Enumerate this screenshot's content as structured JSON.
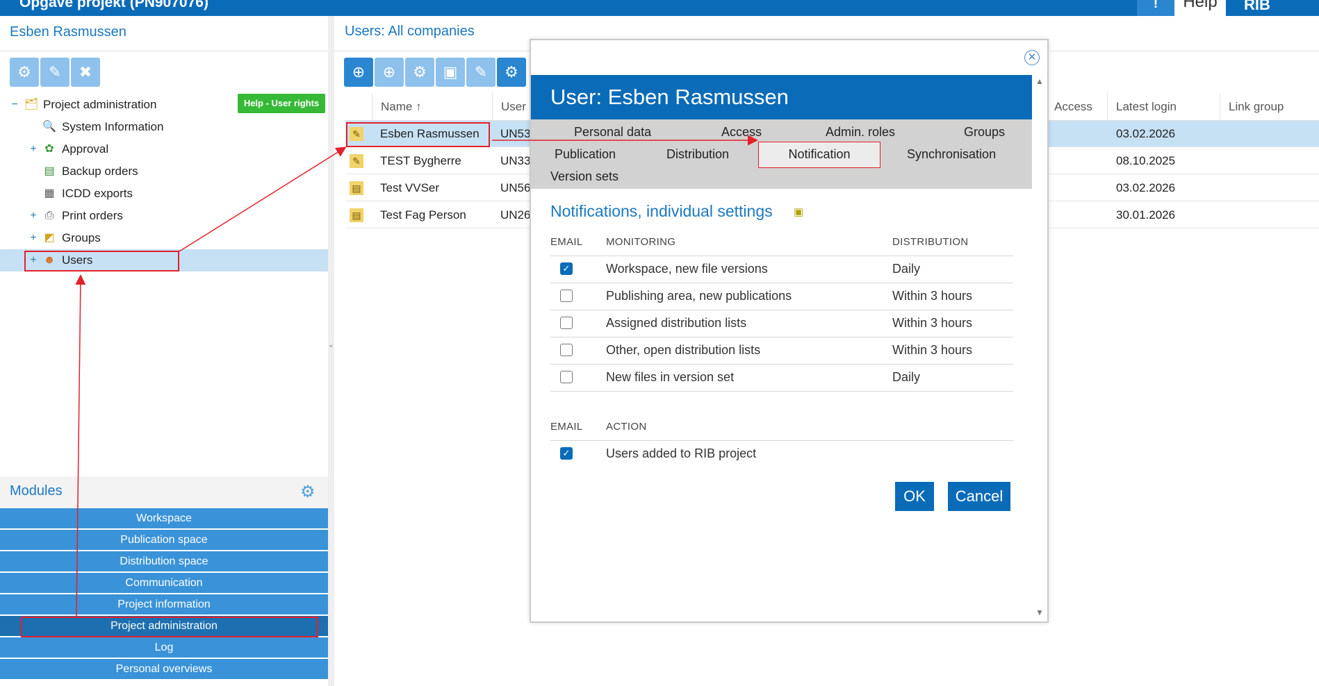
{
  "topbar": {
    "project_title": "Opgave projekt (PN907076)",
    "info_label": "!",
    "help_label": "Help",
    "logo_text": "RIB"
  },
  "left": {
    "user_name": "Esben Rasmussen",
    "toolbar_icons": [
      "settings-gear-icon",
      "edit-icon",
      "delete-settings-icon"
    ],
    "help_badge": "Help - User rights",
    "tree": [
      {
        "label": "Project administration",
        "expander": "−",
        "icon": "folder-admin-icon",
        "level": 0
      },
      {
        "label": "System Information",
        "expander": "",
        "icon": "system-info-icon",
        "level": 1
      },
      {
        "label": "Approval",
        "expander": "+",
        "icon": "approval-icon",
        "level": 1
      },
      {
        "label": "Backup orders",
        "expander": "",
        "icon": "backup-icon",
        "level": 1
      },
      {
        "label": "ICDD exports",
        "expander": "",
        "icon": "export-icon",
        "level": 1
      },
      {
        "label": "Print orders",
        "expander": "+",
        "icon": "printer-icon",
        "level": 1
      },
      {
        "label": "Groups",
        "expander": "+",
        "icon": "groups-icon",
        "level": 1
      },
      {
        "label": "Users",
        "expander": "+",
        "icon": "users-icon",
        "level": 1,
        "selected": true
      }
    ],
    "modules_title": "Modules",
    "modules": [
      "Workspace",
      "Publication space",
      "Distribution space",
      "Communication",
      "Project information",
      "Project administration",
      "Log",
      "Personal overviews"
    ],
    "active_module": "Project administration"
  },
  "main": {
    "title": "Users: All companies",
    "toolbar_icons": [
      "add-user-icon",
      "add-icon",
      "settings-icon",
      "card-icon",
      "edit-icon",
      "settings-dark-icon"
    ],
    "columns": {
      "name": "Name",
      "user": "User",
      "access": "Access",
      "latest_login": "Latest login",
      "link_group": "Link group"
    },
    "rows": [
      {
        "name": "Esben Rasmussen",
        "user": "UN53",
        "latest_login": "03.02.2026",
        "selected": true
      },
      {
        "name": "TEST Bygherre",
        "user": "UN33",
        "latest_login": "08.10.2025"
      },
      {
        "name": "Test VVSer",
        "user": "UN56",
        "latest_login": "03.02.2026"
      },
      {
        "name": "Test Fag Person",
        "user": "UN26",
        "latest_login": "30.01.2026"
      }
    ]
  },
  "modal": {
    "title": "User: Esben Rasmussen",
    "tabs": [
      "Personal data",
      "Access",
      "Admin. roles",
      "Groups",
      "Publication",
      "Distribution",
      "Notification",
      "Synchronisation",
      "Version sets"
    ],
    "active_tab": "Notification",
    "section_title": "Notifications, individual settings",
    "monitoring_headers": {
      "email": "EMAIL",
      "monitoring": "MONITORING",
      "distribution": "DISTRIBUTION"
    },
    "monitoring_rows": [
      {
        "checked": true,
        "monitoring": "Workspace, new file versions",
        "distribution": "Daily"
      },
      {
        "checked": false,
        "monitoring": "Publishing area, new publications",
        "distribution": "Within 3 hours"
      },
      {
        "checked": false,
        "monitoring": "Assigned distribution lists",
        "distribution": "Within 3 hours"
      },
      {
        "checked": false,
        "monitoring": "Other, open distribution lists",
        "distribution": "Within 3 hours"
      },
      {
        "checked": false,
        "monitoring": "New files in version set",
        "distribution": "Daily"
      }
    ],
    "action_headers": {
      "email": "EMAIL",
      "action": "ACTION"
    },
    "action_rows": [
      {
        "checked": true,
        "action": "Users added to RIB project"
      }
    ],
    "ok_label": "OK",
    "cancel_label": "Cancel"
  },
  "colors": {
    "brand_blue": "#0a6bb8",
    "module_blue": "#3a93d8",
    "selection": "#c7e1f4",
    "annotation_red": "#e3202b",
    "help_green": "#36b936"
  }
}
